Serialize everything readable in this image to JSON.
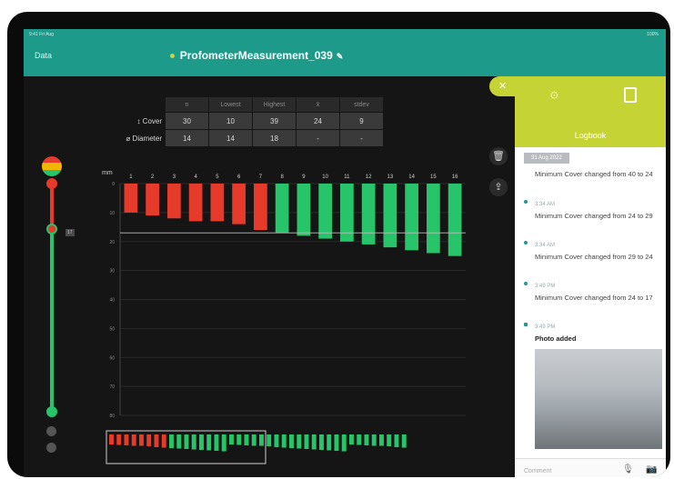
{
  "statusbar": {
    "left": "9:41 Fri Aug",
    "right": "100%"
  },
  "header": {
    "back_label": "Data",
    "title": "ProfometerMeasurement_039"
  },
  "stats": {
    "columns": [
      "n",
      "Lowest",
      "Highest",
      "x̄",
      "stdev"
    ],
    "rows": [
      {
        "label": "↕ Cover",
        "values": [
          "30",
          "10",
          "39",
          "24",
          "9"
        ]
      },
      {
        "label": "⌀ Diameter",
        "values": [
          "14",
          "14",
          "18",
          "-",
          "-"
        ]
      }
    ]
  },
  "slider": {
    "threshold_tag": "17"
  },
  "chart_data": {
    "type": "bar",
    "yunit": "mm",
    "ylim": [
      0,
      80
    ],
    "yticks": [
      0,
      10,
      20,
      30,
      40,
      50,
      60,
      70,
      80
    ],
    "categories": [
      "1",
      "2",
      "3",
      "4",
      "5",
      "6",
      "7",
      "8",
      "9",
      "10",
      "11",
      "12",
      "13",
      "14",
      "15",
      "16"
    ],
    "values": [
      10,
      11,
      12,
      13,
      13,
      14,
      16,
      17,
      18,
      19,
      20,
      21,
      22,
      23,
      24,
      25
    ],
    "threshold": 17,
    "colors": {
      "below": "#e63a2a",
      "above": "#27c46a",
      "grid": "#2a2a2a",
      "threshold": "#bdbdbd"
    }
  },
  "minimap": {
    "bar_count": 40
  },
  "logbook": {
    "title": "Logbook",
    "date": "31 Aug 2022",
    "entries": [
      {
        "time": "",
        "message": "Minimum Cover changed from 40 to 24"
      },
      {
        "time": "3:34 AM",
        "message": "Minimum Cover changed from 24 to 29"
      },
      {
        "time": "3:34 AM",
        "message": "Minimum Cover changed from 29 to 24"
      },
      {
        "time": "3:49 PM",
        "message": "Minimum Cover changed from 24 to 17"
      },
      {
        "time": "3:49 PM",
        "message": "Photo added"
      }
    ],
    "comment_placeholder": "Comment"
  },
  "icons": {
    "delete": "trash-icon",
    "share": "share-icon",
    "settings": "gear-icon",
    "panel": "panel-icon",
    "close": "close-icon",
    "mic": "microphone-icon",
    "camera": "camera-icon"
  }
}
